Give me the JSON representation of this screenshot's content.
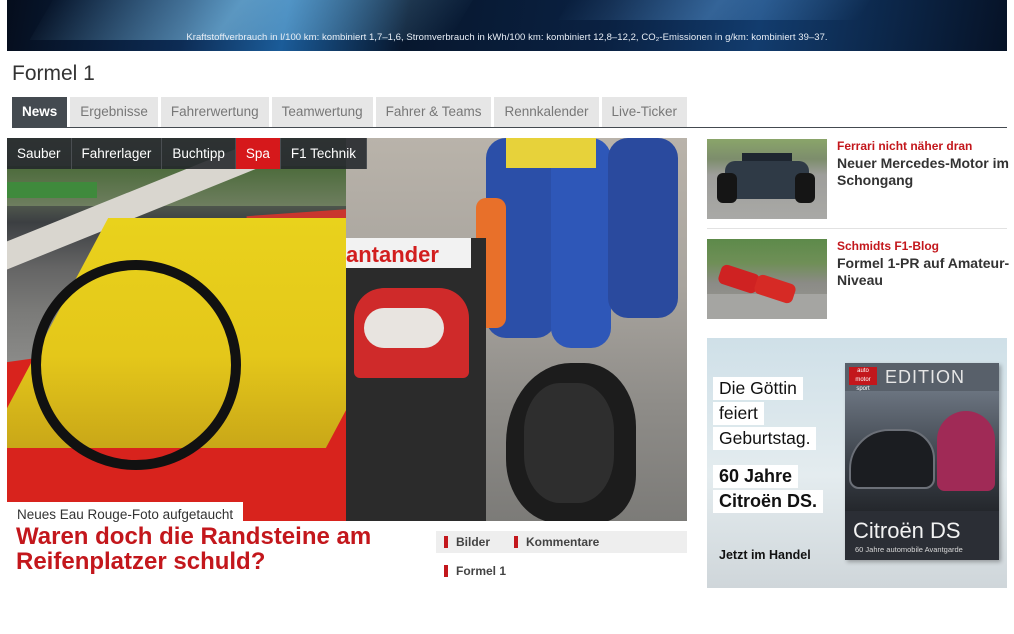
{
  "banner": {
    "text": "Kraftstoffverbrauch in l/100 km: kombiniert 1,7–1,6, Stromverbrauch in kWh/100 km: kombiniert 12,8–12,2, CO₂-Emissionen in g/km: kombiniert 39–37."
  },
  "page": {
    "title": "Formel 1"
  },
  "tabs": [
    {
      "label": "News",
      "active": true
    },
    {
      "label": "Ergebnisse"
    },
    {
      "label": "Fahrerwertung"
    },
    {
      "label": "Teamwertung"
    },
    {
      "label": "Fahrer & Teams"
    },
    {
      "label": "Rennkalender"
    },
    {
      "label": "Live-Ticker"
    }
  ],
  "hero": {
    "tags": [
      {
        "label": "Sauber"
      },
      {
        "label": "Fahrerlager"
      },
      {
        "label": "Buchtipp"
      },
      {
        "label": "Spa",
        "active": true
      },
      {
        "label": "F1 Technik"
      }
    ],
    "car_logo": "antander",
    "kicker": "Neues Eau Rouge-Foto aufgetaucht",
    "headline": "Waren doch die Randsteine am Reifenplatzer schuld?",
    "links": {
      "bilder": "Bilder",
      "kommentare": "Kommentare",
      "category": "Formel 1"
    },
    "accent_color": "#c3171c"
  },
  "sidebar": {
    "articles": [
      {
        "kicker": "Ferrari nicht näher dran",
        "title": "Neuer Mercedes-Motor im Schongang"
      },
      {
        "kicker": "Schmidts F1-Blog",
        "title": "Formel 1-PR auf Amateur-Niveau"
      }
    ]
  },
  "ad": {
    "lines": [
      "Die Göttin",
      "feiert",
      "Geburtstag.",
      "60 Jahre",
      "Citroën DS."
    ],
    "cta": "Jetzt im Handel",
    "book": {
      "logo": "auto motor sport",
      "edition": "EDITION",
      "title": "Citroën DS",
      "subtitle": "60 Jahre automobile Avantgarde"
    }
  }
}
